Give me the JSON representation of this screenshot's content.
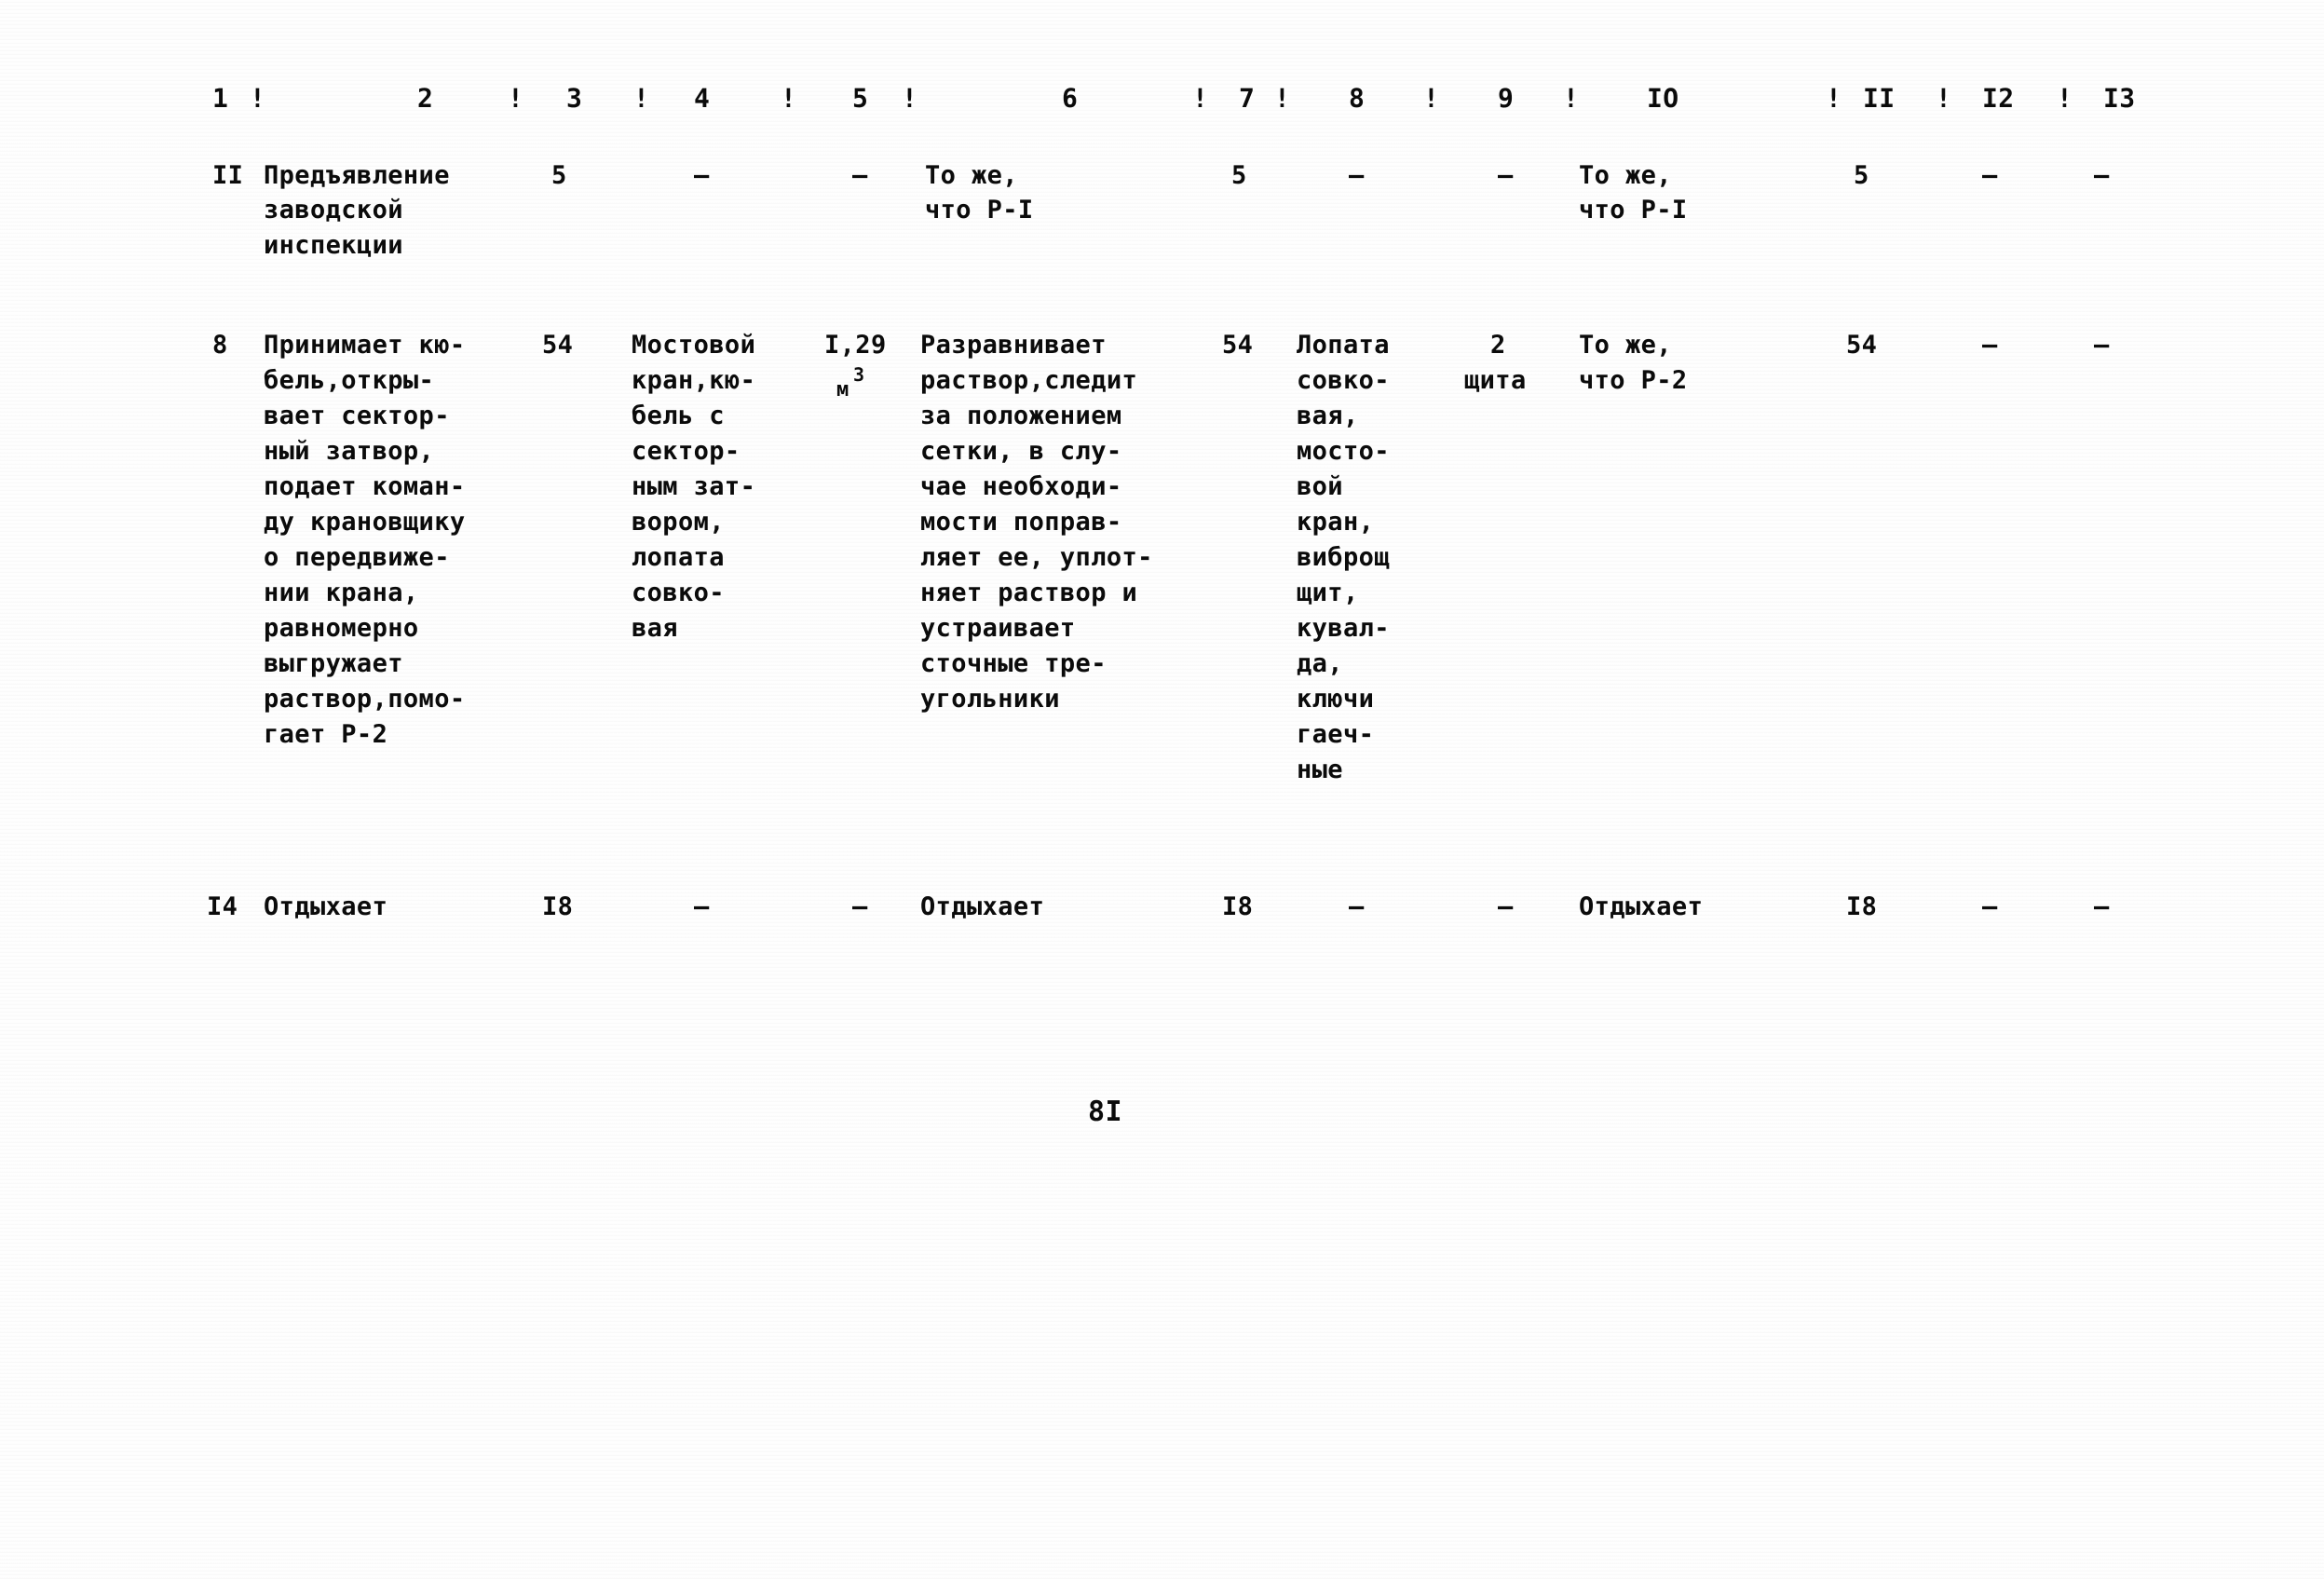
{
  "document": {
    "type": "scanned-typewritten-table",
    "page_number": "8I",
    "language": "ru"
  },
  "table": {
    "column_headers": [
      "1",
      "2",
      "3",
      "4",
      "5",
      "6",
      "7",
      "8",
      "9",
      "IO",
      "II",
      "I2",
      "I3"
    ],
    "header_separator": "!",
    "rows": [
      {
        "c1": "II",
        "c2": [
          "Предъявление",
          "заводской",
          "инспекции"
        ],
        "c3": "5",
        "c4": [
          "–"
        ],
        "c5": "–",
        "c6": [
          "То же,",
          "что Р-I"
        ],
        "c7": "5",
        "c8": [
          "–"
        ],
        "c9": "–",
        "c10": [
          "То же,",
          "что Р-I"
        ],
        "c11": "5",
        "c12": "–",
        "c13": "–"
      },
      {
        "c1": "8",
        "c2": [
          "Принимает кю-",
          "бель,откры-",
          "вает сектор-",
          "ный затвор,",
          "подает коман-",
          "ду крановщику",
          "о передвиже-",
          "нии крана,",
          "равномерно",
          "выгружает",
          "раствор,помо-",
          "гает Р-2"
        ],
        "c3": "54",
        "c4": [
          "Мостовой",
          "кран,кю-",
          "бель с",
          "сектор-",
          "ным зат-",
          "вором,",
          "лопата",
          "совко-",
          "вая"
        ],
        "c5": "I,29",
        "c5_unit": "м",
        "c5_unit_sup": "3",
        "c6": [
          "Разравнивает",
          "раствор,следит",
          "за положением",
          "сетки, в слу-",
          "чае необходи-",
          "мости поправ-",
          "ляет ее, уплот-",
          "няет раствор и",
          "устраивает",
          "сточные тре-",
          "угольники"
        ],
        "c7": "54",
        "c8": [
          "Лопата",
          "совко-",
          "вая,",
          "мосто-",
          "вой",
          "кран,",
          "виброщ",
          "щит,",
          "кувал-",
          "да,",
          "ключи",
          "гаеч-",
          "ные"
        ],
        "c9": "2",
        "c9_line2": "щита",
        "c10": [
          "То же,",
          "что Р-2"
        ],
        "c11": "54",
        "c12": "–",
        "c13": "–"
      },
      {
        "c1": "I4",
        "c2": [
          "Отдыхает"
        ],
        "c3": "I8",
        "c4": [
          "–"
        ],
        "c5": "–",
        "c6": [
          "Отдыхает"
        ],
        "c7": "I8",
        "c8": [
          "–"
        ],
        "c9": "–",
        "c10": [
          "Отдыхает"
        ],
        "c11": "I8",
        "c12": "–",
        "c13": "–"
      }
    ]
  }
}
